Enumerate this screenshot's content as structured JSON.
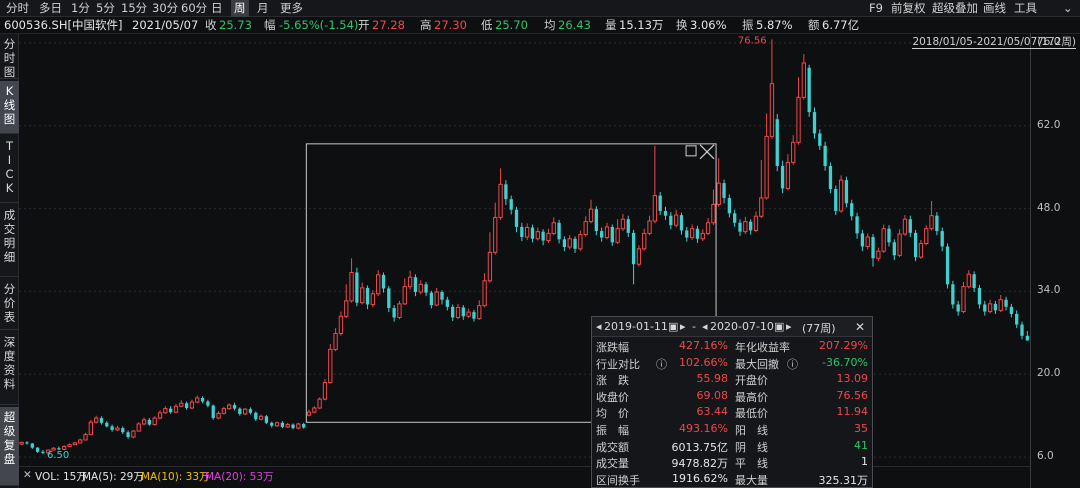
{
  "toolbar": {
    "timeframes": [
      "分时",
      "多日",
      "1分",
      "5分",
      "15分",
      "30分",
      "60分",
      "日",
      "周",
      "月",
      "更多"
    ],
    "active_timeframe": "周",
    "right_items": [
      "F9",
      "前复权",
      "超级叠加",
      "画线",
      "工具"
    ]
  },
  "info": {
    "code": "600536.SH[中国软件]",
    "date": "2021/05/07",
    "close_label": "收",
    "close": "25.73",
    "change_label": "幅",
    "change": "-5.65%(-1.54)",
    "open_label": "开",
    "open": "27.28",
    "high_label": "高",
    "high": "27.30",
    "low_label": "低",
    "low": "25.70",
    "avg_label": "均",
    "avg": "26.43",
    "volume_label": "量",
    "volume": "15.13万",
    "turnover_label": "换",
    "turnover": "3.06%",
    "amplitude_label": "振",
    "amplitude": "5.87%",
    "amount_label": "额",
    "amount": "6.77亿"
  },
  "side_tabs": [
    {
      "label": "分时图",
      "active": false
    },
    {
      "label": "K线图",
      "active": true
    },
    {
      "label": "TICK",
      "active": false
    },
    {
      "label": "成交明细",
      "active": false
    },
    {
      "label": "分价表",
      "active": false
    },
    {
      "label": "深度资料",
      "active": false
    },
    {
      "label": "超级复盘",
      "active": true
    }
  ],
  "date_range": "2018/01/05-2021/05/07(172周)",
  "price_ticks": [
    "76.0",
    "62.0",
    "48.0",
    "34.0",
    "20.0",
    "6.0"
  ],
  "annotations": {
    "high_label": "76.56",
    "low_label": "6.50"
  },
  "volume_bar": {
    "vol": "VOL: 15万",
    "ma5": "MA(5): 29万",
    "ma10": "MA(10): 33万",
    "ma20": "MA(20): 53万",
    "colors": {
      "vol": "#e6e6e6",
      "ma5": "#e6e6e6",
      "ma10": "#f0c000",
      "ma20": "#e040e0"
    }
  },
  "stats": {
    "start_date": "2019-01-11",
    "separator": "-",
    "end_date": "2020-07-10",
    "weeks": "(77周)",
    "rows": [
      {
        "l1": "涨跌幅",
        "v1": "427.16%",
        "c1": "red",
        "l2": "年化收益率",
        "v2": "207.29%",
        "c2": "red"
      },
      {
        "l1": "行业对比",
        "v1": "102.66%",
        "c1": "red",
        "l2": "最大回撤",
        "v2": "-36.70%",
        "c2": "green"
      },
      {
        "l1": "涨　跌",
        "v1": "55.98",
        "c1": "red",
        "l2": "开盘价",
        "v2": "13.09",
        "c2": "red"
      },
      {
        "l1": "收盘价",
        "v1": "69.08",
        "c1": "red",
        "l2": "最高价",
        "v2": "76.56",
        "c2": "red"
      },
      {
        "l1": "均　价",
        "v1": "63.44",
        "c1": "red",
        "l2": "最低价",
        "v2": "11.94",
        "c2": "red"
      },
      {
        "l1": "振　幅",
        "v1": "493.16%",
        "c1": "red",
        "l2": "阳　线",
        "v2": "35",
        "c2": "red"
      },
      {
        "l1": "成交额",
        "v1": "6013.75亿",
        "c1": "white",
        "l2": "阴　线",
        "v2": "41",
        "c2": "green"
      },
      {
        "l1": "成交量",
        "v1": "9478.82万",
        "c1": "white",
        "l2": "平　线",
        "v2": "1",
        "c2": "white"
      },
      {
        "l1": "区间换手",
        "v1": "1916.62%",
        "c1": "white",
        "l2": "最大量",
        "v2": "325.31万",
        "c2": "white"
      }
    ]
  },
  "chart_data": {
    "type": "candlestick",
    "y_ticks": [
      6,
      20,
      34,
      48,
      62,
      76
    ],
    "ylim": [
      4.5,
      77.5
    ],
    "colors": {
      "up": "#f04848",
      "down": "#40d0d0",
      "grid": "#2a2b30",
      "selection": "#c8c8c8"
    },
    "selection_start_index": 54,
    "selection_end_index": 130,
    "candles": [
      [
        8.2,
        8.5,
        8.6,
        8.0
      ],
      [
        8.5,
        8.3,
        8.7,
        8.1
      ],
      [
        8.3,
        7.6,
        8.4,
        7.4
      ],
      [
        7.6,
        6.9,
        7.7,
        6.7
      ],
      [
        6.9,
        6.7,
        7.2,
        6.5
      ],
      [
        6.7,
        7.2,
        7.3,
        6.6
      ],
      [
        7.2,
        7.5,
        7.7,
        7.1
      ],
      [
        7.5,
        7.3,
        7.8,
        7.2
      ],
      [
        7.3,
        7.8,
        8.0,
        7.2
      ],
      [
        7.8,
        8.1,
        8.3,
        7.7
      ],
      [
        8.1,
        8.4,
        8.6,
        8.0
      ],
      [
        8.4,
        8.9,
        9.1,
        8.3
      ],
      [
        8.9,
        9.8,
        10.1,
        8.8
      ],
      [
        9.8,
        11.9,
        12.3,
        9.7
      ],
      [
        11.9,
        12.6,
        13.0,
        11.7
      ],
      [
        12.6,
        11.8,
        12.9,
        11.5
      ],
      [
        11.8,
        11.2,
        12.1,
        11.0
      ],
      [
        11.2,
        10.6,
        11.5,
        10.3
      ],
      [
        10.6,
        10.9,
        11.3,
        10.4
      ],
      [
        10.9,
        10.2,
        11.2,
        9.9
      ],
      [
        10.2,
        9.4,
        10.5,
        9.1
      ],
      [
        9.4,
        10.4,
        10.6,
        9.2
      ],
      [
        10.4,
        11.6,
        11.9,
        10.3
      ],
      [
        11.6,
        12.3,
        12.7,
        11.4
      ],
      [
        12.3,
        11.5,
        12.6,
        11.3
      ],
      [
        11.5,
        12.6,
        12.9,
        11.3
      ],
      [
        12.6,
        13.5,
        13.9,
        12.4
      ],
      [
        13.5,
        14.2,
        14.6,
        13.3
      ],
      [
        14.2,
        13.6,
        14.6,
        13.3
      ],
      [
        13.6,
        14.6,
        15.0,
        13.4
      ],
      [
        14.6,
        15.1,
        15.6,
        14.4
      ],
      [
        15.1,
        14.3,
        15.4,
        14.0
      ],
      [
        14.3,
        15.3,
        15.7,
        14.1
      ],
      [
        15.3,
        16.0,
        16.4,
        15.1
      ],
      [
        16.0,
        15.4,
        16.3,
        15.1
      ],
      [
        15.4,
        14.7,
        15.7,
        14.4
      ],
      [
        14.7,
        12.6,
        14.9,
        12.3
      ],
      [
        12.6,
        13.4,
        13.8,
        12.4
      ],
      [
        13.4,
        14.2,
        14.5,
        13.2
      ],
      [
        14.2,
        14.8,
        15.1,
        14.0
      ],
      [
        14.8,
        14.2,
        15.2,
        13.9
      ],
      [
        14.2,
        13.3,
        14.4,
        13.0
      ],
      [
        13.3,
        14.1,
        14.3,
        13.1
      ],
      [
        14.1,
        13.5,
        14.4,
        13.2
      ],
      [
        13.5,
        12.4,
        13.7,
        12.1
      ],
      [
        12.4,
        12.9,
        13.2,
        12.2
      ],
      [
        12.9,
        11.8,
        13.1,
        11.6
      ],
      [
        11.8,
        11.3,
        12.0,
        11.0
      ],
      [
        11.3,
        11.8,
        12.0,
        11.1
      ],
      [
        11.8,
        11.1,
        12.1,
        10.9
      ],
      [
        11.1,
        11.5,
        11.8,
        10.9
      ],
      [
        11.5,
        10.9,
        11.7,
        10.7
      ],
      [
        10.9,
        11.6,
        11.8,
        10.7
      ],
      [
        11.6,
        11.0,
        11.8,
        10.8
      ],
      [
        13.1,
        13.6,
        14.0,
        12.9
      ],
      [
        13.6,
        14.3,
        14.6,
        13.4
      ],
      [
        14.3,
        15.8,
        16.1,
        14.1
      ],
      [
        15.8,
        18.6,
        19.2,
        15.6
      ],
      [
        18.6,
        24.2,
        25.1,
        18.4
      ],
      [
        24.2,
        26.9,
        27.8,
        23.9
      ],
      [
        26.9,
        29.8,
        30.6,
        26.5
      ],
      [
        29.8,
        32.4,
        35.2,
        29.5
      ],
      [
        32.4,
        37.2,
        39.6,
        32.1
      ],
      [
        37.2,
        32.1,
        38.0,
        31.5
      ],
      [
        32.1,
        34.6,
        35.5,
        31.8
      ],
      [
        34.6,
        31.8,
        35.0,
        31.0
      ],
      [
        31.8,
        33.6,
        34.2,
        31.3
      ],
      [
        33.6,
        36.8,
        37.6,
        33.2
      ],
      [
        36.8,
        34.5,
        37.2,
        33.8
      ],
      [
        34.5,
        31.2,
        34.9,
        30.5
      ],
      [
        31.2,
        29.6,
        31.7,
        28.9
      ],
      [
        29.6,
        31.9,
        32.4,
        29.3
      ],
      [
        31.9,
        34.8,
        36.2,
        31.7
      ],
      [
        34.8,
        36.4,
        37.5,
        34.3
      ],
      [
        36.4,
        33.9,
        36.9,
        33.2
      ],
      [
        33.9,
        35.2,
        35.9,
        33.5
      ],
      [
        35.2,
        33.8,
        35.6,
        33.2
      ],
      [
        33.8,
        31.7,
        34.1,
        31.1
      ],
      [
        31.7,
        33.9,
        34.6,
        31.5
      ],
      [
        33.9,
        32.6,
        34.2,
        31.8
      ],
      [
        32.6,
        31.4,
        33.1,
        30.8
      ],
      [
        31.4,
        29.6,
        31.8,
        29.0
      ],
      [
        29.6,
        31.3,
        31.9,
        29.3
      ],
      [
        31.3,
        29.8,
        31.7,
        29.2
      ],
      [
        29.8,
        30.5,
        31.1,
        29.5
      ],
      [
        30.5,
        29.4,
        30.9,
        28.9
      ],
      [
        29.4,
        31.6,
        32.5,
        29.2
      ],
      [
        31.6,
        35.8,
        37.1,
        31.3
      ],
      [
        35.8,
        40.6,
        44.0,
        35.5
      ],
      [
        40.6,
        46.5,
        49.0,
        40.2
      ],
      [
        46.5,
        52.1,
        54.8,
        46.1
      ],
      [
        52.1,
        49.6,
        52.8,
        48.6
      ],
      [
        49.6,
        47.8,
        50.2,
        47.0
      ],
      [
        47.8,
        44.9,
        48.3,
        44.0
      ],
      [
        44.9,
        43.2,
        45.6,
        42.5
      ],
      [
        43.2,
        44.8,
        45.5,
        42.7
      ],
      [
        44.8,
        42.9,
        45.3,
        42.3
      ],
      [
        42.9,
        44.1,
        44.8,
        42.6
      ],
      [
        44.1,
        42.6,
        44.5,
        41.8
      ],
      [
        42.6,
        43.8,
        44.6,
        42.2
      ],
      [
        43.8,
        45.6,
        46.5,
        43.5
      ],
      [
        45.6,
        42.8,
        46.1,
        42.1
      ],
      [
        42.8,
        41.5,
        43.3,
        40.8
      ],
      [
        41.5,
        42.9,
        43.5,
        41.1
      ],
      [
        42.9,
        41.2,
        43.3,
        40.5
      ],
      [
        41.2,
        43.6,
        44.3,
        40.9
      ],
      [
        43.6,
        45.8,
        46.7,
        43.3
      ],
      [
        45.8,
        47.9,
        49.5,
        45.5
      ],
      [
        47.9,
        44.2,
        48.4,
        43.5
      ],
      [
        44.2,
        43.1,
        44.8,
        42.4
      ],
      [
        43.1,
        44.9,
        45.6,
        42.8
      ],
      [
        44.9,
        42.3,
        45.3,
        41.7
      ],
      [
        42.3,
        44.6,
        46.2,
        42.0
      ],
      [
        44.6,
        46.2,
        47.1,
        44.2
      ],
      [
        46.2,
        43.9,
        46.8,
        43.2
      ],
      [
        43.9,
        38.6,
        44.4,
        35.2
      ],
      [
        38.6,
        41.2,
        41.8,
        38.2
      ],
      [
        41.2,
        43.8,
        44.6,
        40.9
      ],
      [
        43.8,
        45.9,
        46.8,
        43.5
      ],
      [
        45.9,
        50.2,
        58.6,
        45.5
      ],
      [
        50.2,
        47.6,
        50.8,
        46.9
      ],
      [
        47.6,
        46.8,
        48.3,
        46.1
      ],
      [
        46.8,
        45.2,
        47.4,
        44.5
      ],
      [
        45.2,
        46.9,
        47.8,
        44.8
      ],
      [
        46.9,
        44.3,
        47.3,
        43.6
      ],
      [
        44.3,
        43.1,
        44.9,
        42.4
      ],
      [
        43.1,
        44.6,
        45.3,
        42.7
      ],
      [
        44.6,
        42.9,
        45.1,
        42.2
      ],
      [
        42.9,
        43.8,
        44.5,
        42.5
      ],
      [
        43.8,
        45.6,
        46.4,
        43.5
      ],
      [
        45.6,
        48.7,
        51.2,
        45.2
      ],
      [
        48.7,
        52.3,
        56.5,
        48.3
      ],
      [
        52.3,
        49.8,
        52.9,
        48.9
      ],
      [
        49.8,
        47.2,
        50.4,
        46.5
      ],
      [
        47.2,
        45.6,
        47.8,
        44.9
      ],
      [
        45.6,
        44.1,
        46.2,
        43.4
      ],
      [
        44.1,
        45.8,
        46.6,
        43.7
      ],
      [
        45.8,
        44.3,
        46.2,
        43.6
      ],
      [
        44.3,
        46.7,
        47.5,
        44.0
      ],
      [
        46.7,
        49.8,
        56.2,
        46.4
      ],
      [
        49.8,
        60.2,
        64.1,
        49.5
      ],
      [
        60.2,
        69.1,
        76.6,
        59.8
      ],
      [
        63.1,
        55.2,
        64.0,
        54.3
      ],
      [
        55.2,
        51.4,
        56.1,
        50.6
      ],
      [
        51.4,
        55.8,
        57.2,
        51.1
      ],
      [
        55.8,
        59.2,
        60.4,
        55.4
      ],
      [
        59.2,
        66.8,
        70.2,
        58.8
      ],
      [
        66.8,
        72.6,
        74.1,
        66.4
      ],
      [
        71.8,
        64.3,
        72.3,
        63.5
      ],
      [
        64.3,
        60.7,
        65.1,
        59.8
      ],
      [
        60.7,
        58.6,
        61.4,
        57.9
      ],
      [
        58.6,
        55.2,
        59.3,
        54.4
      ],
      [
        55.2,
        51.3,
        55.8,
        50.6
      ],
      [
        51.3,
        47.6,
        51.9,
        46.9
      ],
      [
        47.6,
        52.8,
        53.6,
        47.3
      ],
      [
        52.8,
        48.9,
        53.4,
        48.2
      ],
      [
        48.9,
        46.7,
        49.5,
        46.0
      ],
      [
        46.7,
        43.8,
        47.3,
        42.9
      ],
      [
        43.8,
        41.6,
        44.4,
        40.8
      ],
      [
        41.6,
        43.2,
        43.8,
        41.1
      ],
      [
        43.2,
        39.6,
        43.7,
        38.2
      ],
      [
        39.6,
        40.8,
        41.4,
        39.1
      ],
      [
        40.8,
        44.6,
        45.3,
        40.5
      ],
      [
        44.6,
        42.3,
        45.2,
        41.6
      ],
      [
        42.3,
        40.1,
        42.8,
        39.3
      ],
      [
        40.1,
        43.7,
        44.5,
        39.8
      ],
      [
        43.7,
        46.2,
        46.9,
        43.4
      ],
      [
        46.2,
        43.9,
        46.8,
        43.2
      ],
      [
        43.9,
        39.8,
        44.4,
        39.1
      ],
      [
        39.8,
        42.1,
        42.7,
        39.5
      ],
      [
        42.1,
        44.6,
        45.2,
        41.8
      ],
      [
        44.6,
        46.8,
        49.3,
        44.3
      ],
      [
        46.8,
        44.2,
        47.4,
        43.5
      ],
      [
        44.2,
        41.6,
        44.8,
        40.8
      ],
      [
        41.6,
        35.2,
        42.1,
        34.5
      ],
      [
        35.2,
        31.8,
        35.8,
        31.1
      ],
      [
        31.8,
        30.6,
        32.4,
        29.9
      ],
      [
        30.6,
        34.8,
        35.6,
        30.3
      ],
      [
        34.8,
        36.9,
        37.6,
        34.5
      ],
      [
        36.9,
        34.6,
        37.4,
        33.9
      ],
      [
        34.6,
        31.8,
        35.1,
        31.1
      ],
      [
        31.8,
        30.6,
        32.4,
        29.9
      ],
      [
        30.6,
        31.9,
        32.6,
        30.3
      ],
      [
        31.9,
        30.8,
        32.4,
        30.2
      ],
      [
        30.8,
        32.6,
        33.4,
        30.5
      ],
      [
        32.6,
        31.4,
        33.1,
        30.8
      ],
      [
        31.4,
        30.2,
        31.9,
        29.6
      ],
      [
        30.2,
        28.4,
        30.8,
        27.8
      ],
      [
        28.4,
        26.5,
        28.9,
        25.9
      ],
      [
        26.5,
        25.7,
        27.3,
        25.7
      ]
    ]
  }
}
